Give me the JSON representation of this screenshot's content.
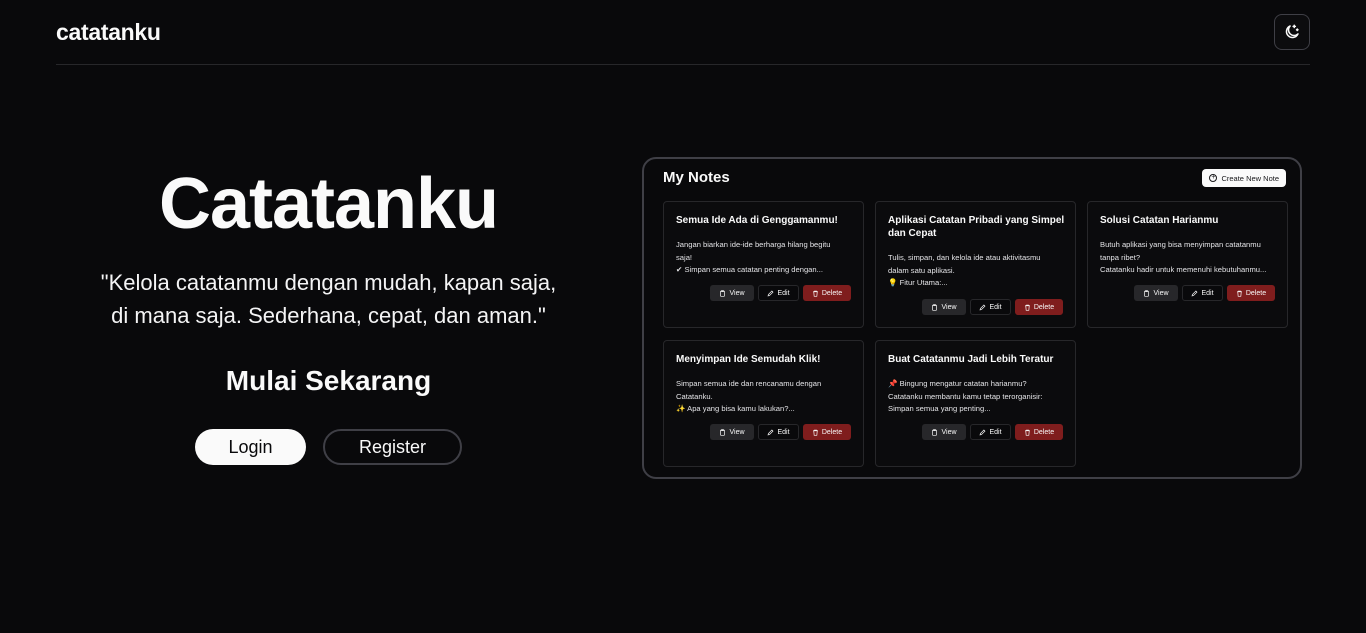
{
  "header": {
    "brand": "catatanku",
    "theme_toggle_icon": "moon-stars-icon"
  },
  "hero": {
    "title": "Catatanku",
    "quote_line1": "\"Kelola catatanmu dengan mudah, kapan saja,",
    "quote_line2": "di mana saja. Sederhana, cepat, dan aman.\"",
    "cta_heading": "Mulai Sekarang",
    "login_label": "Login",
    "register_label": "Register"
  },
  "preview": {
    "title": "My Notes",
    "create_label": "Create New Note",
    "actions": {
      "view": "View",
      "edit": "Edit",
      "delete": "Delete"
    },
    "notes": [
      {
        "title": "Semua Ide Ada di Genggamanmu!",
        "line1": "Jangan biarkan ide-ide berharga hilang begitu",
        "line2": "saja!",
        "line3": "✔ Simpan semua catatan penting dengan..."
      },
      {
        "title": "Aplikasi Catatan Pribadi yang Simpel dan Cepat",
        "line1": "Tulis, simpan, dan kelola ide atau aktivitasmu",
        "line2": "dalam satu aplikasi.",
        "line3": "💡 Fitur Utama:..."
      },
      {
        "title": "Solusi Catatan Harianmu",
        "line1": "Butuh aplikasi yang bisa menyimpan catatanmu",
        "line2": "tanpa ribet?",
        "line3": "Catatanku hadir untuk memenuhi kebutuhanmu..."
      },
      {
        "title": "Menyimpan Ide Semudah Klik!",
        "line1": "Simpan semua ide dan rencanamu dengan",
        "line2": "Catatanku.",
        "line3": "✨ Apa yang bisa kamu lakukan?..."
      },
      {
        "title": "Buat Catatanmu Jadi Lebih Teratur",
        "line1": "📌 Bingung mengatur catatan harianmu?",
        "line2": "Catatanku membantu kamu tetap terorganisir:",
        "line3": "Simpan semua yang penting..."
      }
    ]
  },
  "colors": {
    "background": "#09090b",
    "border": "#27272a",
    "delete": "#7f1d1d",
    "view": "#27272a"
  }
}
